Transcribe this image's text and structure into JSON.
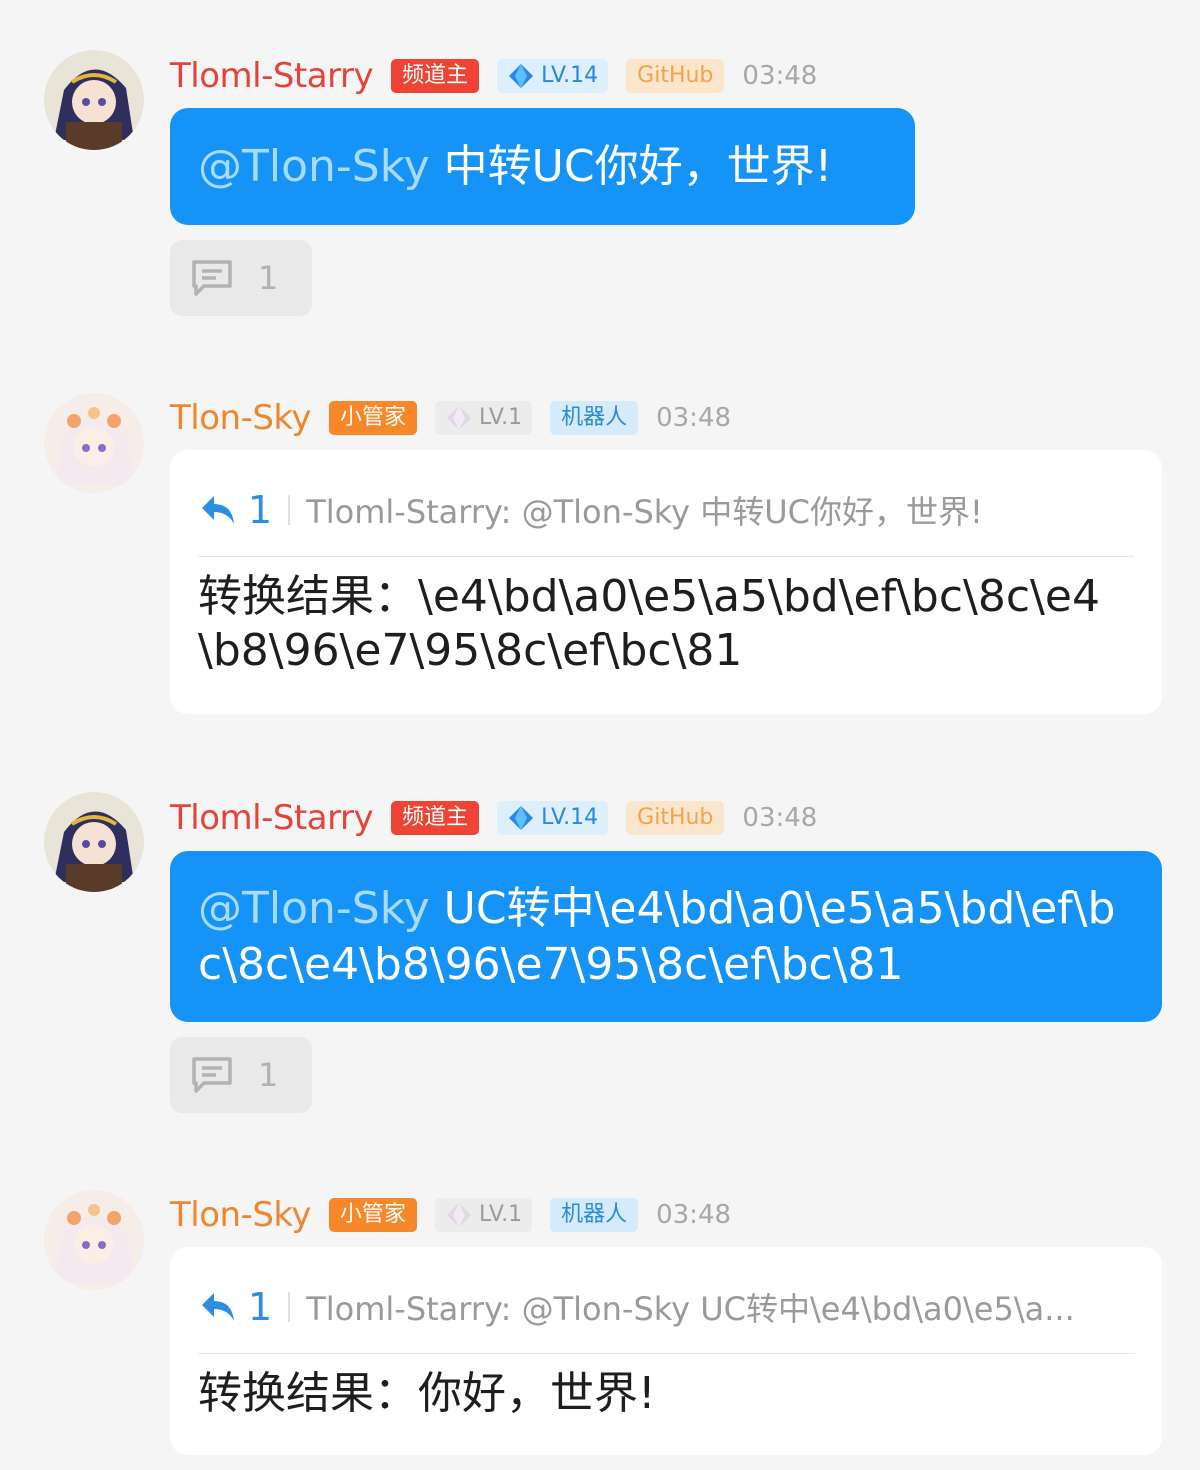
{
  "messages": [
    {
      "sender": "Tloml-Starry",
      "role_badge": "频道主",
      "level": "LV.14",
      "tag": "GitHub",
      "time": "03:48",
      "mention": "@Tlon-Sky",
      "text": " 中转UC你好，世界!",
      "reply_count": "1"
    },
    {
      "sender": "Tlon-Sky",
      "role_badge": "小管家",
      "level": "LV.1",
      "tag": "机器人",
      "time": "03:48",
      "quote_count": "1",
      "quote_text": "Tloml-Starry: @Tlon-Sky 中转UC你好，世界!",
      "result": "转换结果：\\e4\\bd\\a0\\e5\\a5\\bd\\ef\\bc\\8c\\e4\\b8\\96\\e7\\95\\8c\\ef\\bc\\81"
    },
    {
      "sender": "Tloml-Starry",
      "role_badge": "频道主",
      "level": "LV.14",
      "tag": "GitHub",
      "time": "03:48",
      "mention": "@Tlon-Sky",
      "text": " UC转中\\e4\\bd\\a0\\e5\\a5\\bd\\ef\\bc\\8c\\e4\\b8\\96\\e7\\95\\8c\\ef\\bc\\81",
      "reply_count": "1"
    },
    {
      "sender": "Tlon-Sky",
      "role_badge": "小管家",
      "level": "LV.1",
      "tag": "机器人",
      "time": "03:48",
      "quote_count": "1",
      "quote_text": "Tloml-Starry: @Tlon-Sky UC转中\\e4\\bd\\a0\\e5\\a...",
      "result": "转换结果：你好，世界!"
    }
  ],
  "icons": {
    "comment": "comment-icon",
    "reply": "reply-arrow-icon",
    "diamond": "level-diamond-icon"
  },
  "colors": {
    "owner_name": "#e5433a",
    "bot_name": "#f0852b",
    "bubble": "#1693f6",
    "accent": "#2b8ee2"
  }
}
